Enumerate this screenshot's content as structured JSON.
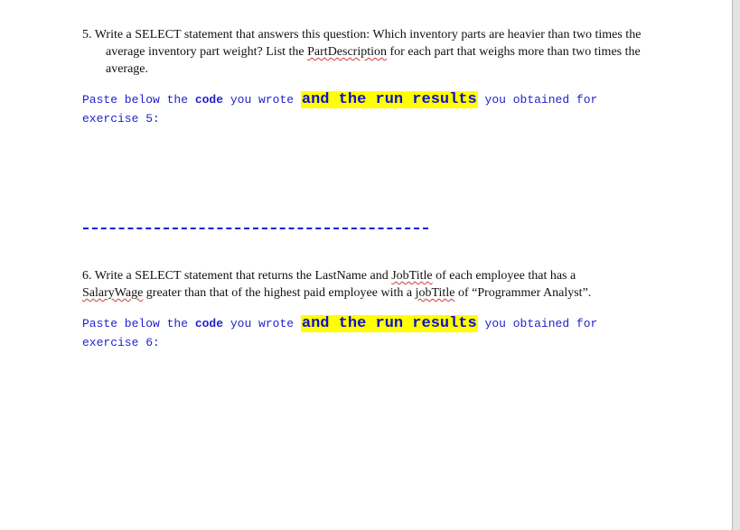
{
  "exercise5": {
    "number": "5.",
    "question_part1": "Write a SELECT statement that answers this question: Which inventory parts are heavier than two times the average inventory part weight?   List the ",
    "question_term": "PartDescription",
    "question_part2": " for each part that weighs more than two times the average.",
    "instruction": {
      "prefix": "Paste below the ",
      "bold": "code",
      "middle": " you wrote ",
      "highlight": "and the run results",
      "suffix": " you obtained for exercise 5:"
    }
  },
  "separator": "dashed-line",
  "exercise6": {
    "number": "6.",
    "question_part1": "Write a SELECT statement that returns the LastName and ",
    "term1": "JobTitle",
    "question_part2": " of each employee that has a ",
    "term2": "SalaryWage",
    "question_part3": " greater than that of the highest paid employee with a ",
    "term3": "jobTitle",
    "question_part4": " of “Programmer Analyst”.",
    "instruction": {
      "prefix": "Paste below the ",
      "bold": "code",
      "middle": " you wrote ",
      "highlight": "and the run results",
      "suffix": " you obtained for exercise 6:"
    }
  },
  "colors": {
    "instruction_text": "#1f1fd0",
    "highlight": "#ffff00",
    "separator": "#1a1ad0"
  }
}
